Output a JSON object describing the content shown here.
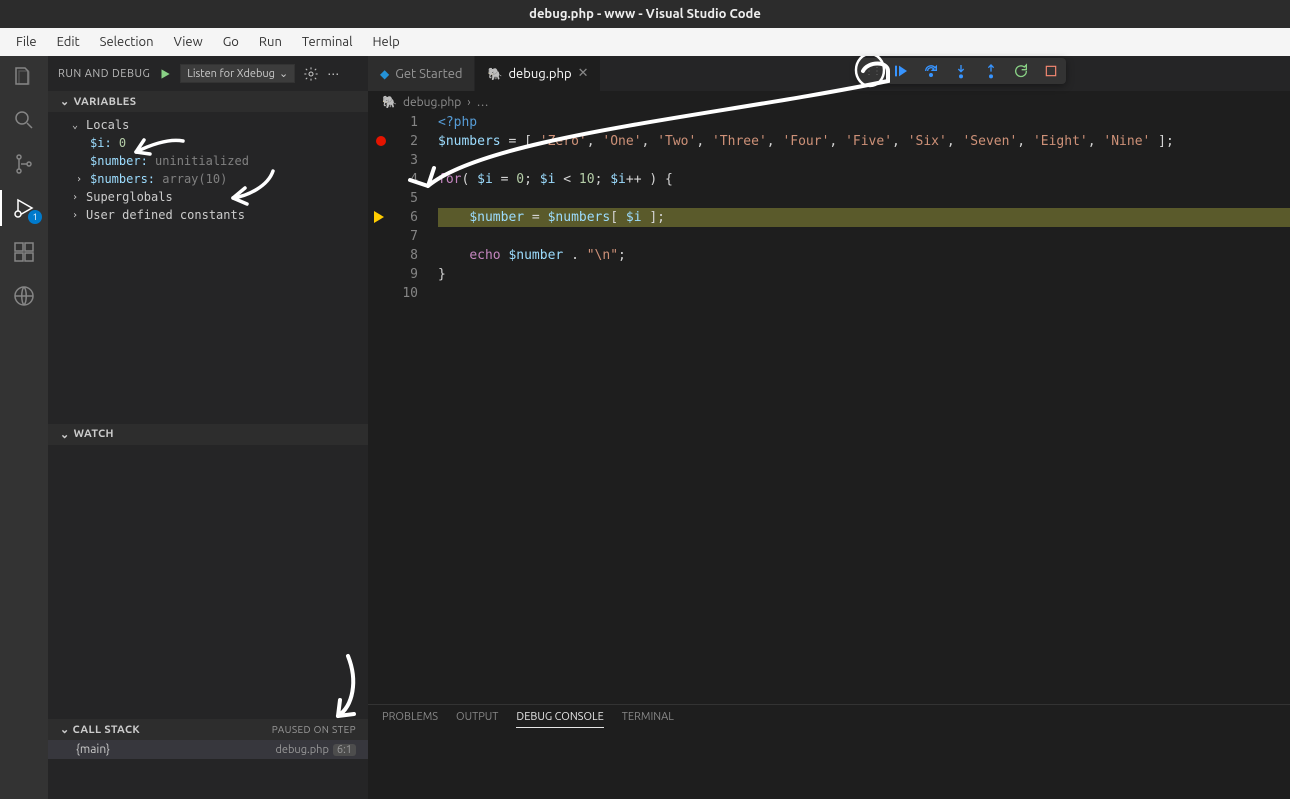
{
  "window": {
    "title": "debug.php - www - Visual Studio Code"
  },
  "menu": {
    "items": [
      "File",
      "Edit",
      "Selection",
      "View",
      "Go",
      "Run",
      "Terminal",
      "Help"
    ]
  },
  "activity": {
    "badge": "1"
  },
  "sidebar": {
    "title": "RUN AND DEBUG",
    "config": "Listen for Xdebug",
    "sections": {
      "variables": "VARIABLES",
      "watch": "WATCH",
      "callstack": "CALL STACK",
      "callstack_status": "PAUSED ON STEP"
    },
    "locals_label": "Locals",
    "vars": {
      "i": {
        "name": "$i:",
        "value": "0"
      },
      "number": {
        "name": "$number:",
        "value": "uninitialized"
      },
      "numbers": {
        "name": "$numbers:",
        "value": "array(10)"
      }
    },
    "superglobals": "Superglobals",
    "userconstants": "User defined constants",
    "callstack_row": {
      "name": "{main}",
      "file": "debug.php",
      "loc": "6:1"
    }
  },
  "tabs": {
    "getstarted": "Get Started",
    "debug": "debug.php"
  },
  "breadcrumb": {
    "file": "debug.php",
    "rest": "…"
  },
  "code": {
    "lines": [
      "1",
      "2",
      "3",
      "4",
      "5",
      "6",
      "7",
      "8",
      "9",
      "10"
    ],
    "l1": "<?php",
    "l2_var": "$numbers",
    "l2_rest": " = [ 'Zero', 'One', 'Two', 'Three', 'Four', 'Five', 'Six', 'Seven', 'Eight', 'Nine' ];",
    "l4_for": "for",
    "l4_rest1": "( ",
    "l4_i1": "$i",
    "l4_eq": " = ",
    "l4_z": "0",
    "l4_semi": "; ",
    "l4_i2": "$i",
    "l4_lt": " < ",
    "l4_ten": "10",
    "l4_semi2": "; ",
    "l4_i3": "$i",
    "l4_pp": "++ ) {",
    "l6_num": "$number",
    "l6_eq": " = ",
    "l6_nums": "$numbers",
    "l6_br": "[ ",
    "l6_i": "$i",
    "l6_end": " ];",
    "l8_echo": "echo",
    "l8_num": "$number",
    "l8_dot": " . ",
    "l8_nl": "\"\\n\"",
    "l8_semi": ";",
    "l9": "}"
  },
  "panel": {
    "tabs": [
      "PROBLEMS",
      "OUTPUT",
      "DEBUG CONSOLE",
      "TERMINAL"
    ],
    "active": 2
  }
}
